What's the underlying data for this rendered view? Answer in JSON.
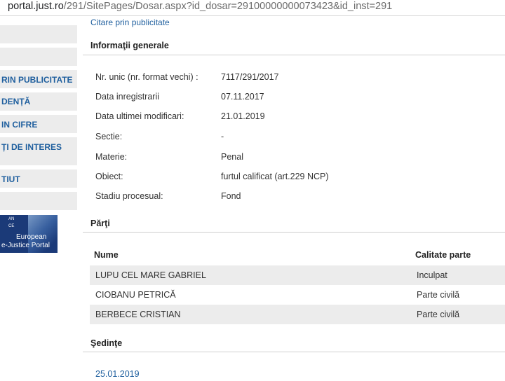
{
  "browser": {
    "url_domain": "portal.just.ro",
    "url_path": "/291/SitePages/Dosar.aspx?id_dosar=29100000000073423&id_inst=291"
  },
  "sidebar": {
    "items": [
      {
        "label": ""
      },
      {
        "label": ""
      },
      {
        "label": "RIN PUBLICITATE"
      },
      {
        "label": "DENȚĂ"
      },
      {
        "label": "IN CIFRE"
      },
      {
        "label": "ȚI DE INTERES"
      },
      {
        "label": "TIUT"
      },
      {
        "label": ""
      }
    ],
    "banner": {
      "line1": "European",
      "line2": "e-Justice Portal",
      "corner_a": "AN",
      "corner_b": "CE"
    }
  },
  "main": {
    "top_link": "Citare prin publicitate",
    "general_title": "Informaţii generale",
    "fields": [
      {
        "label": "Nr. unic (nr. format vechi) :",
        "value": "7117/291/2017"
      },
      {
        "label": "Data inregistrarii",
        "value": "07.11.2017"
      },
      {
        "label": "Data ultimei modificari:",
        "value": "21.01.2019"
      },
      {
        "label": "Sectie:",
        "value": "-"
      },
      {
        "label": "Materie:",
        "value": "Penal"
      },
      {
        "label": "Obiect:",
        "value": "furtul calificat (art.229 NCP)"
      },
      {
        "label": "Stadiu procesual:",
        "value": "Fond"
      }
    ],
    "parties_title": "Părţi",
    "parties_headers": [
      "Nume",
      "Calitate parte"
    ],
    "parties": [
      {
        "name": "LUPU CEL MARE GABRIEL",
        "role": "Inculpat"
      },
      {
        "name": "CIOBANU PETRICĂ",
        "role": "Parte civilă"
      },
      {
        "name": "BERBECE CRISTIAN",
        "role": "Parte civilă"
      }
    ],
    "sessions_title": "Şedinţe",
    "session_date": "25.01.2019"
  }
}
